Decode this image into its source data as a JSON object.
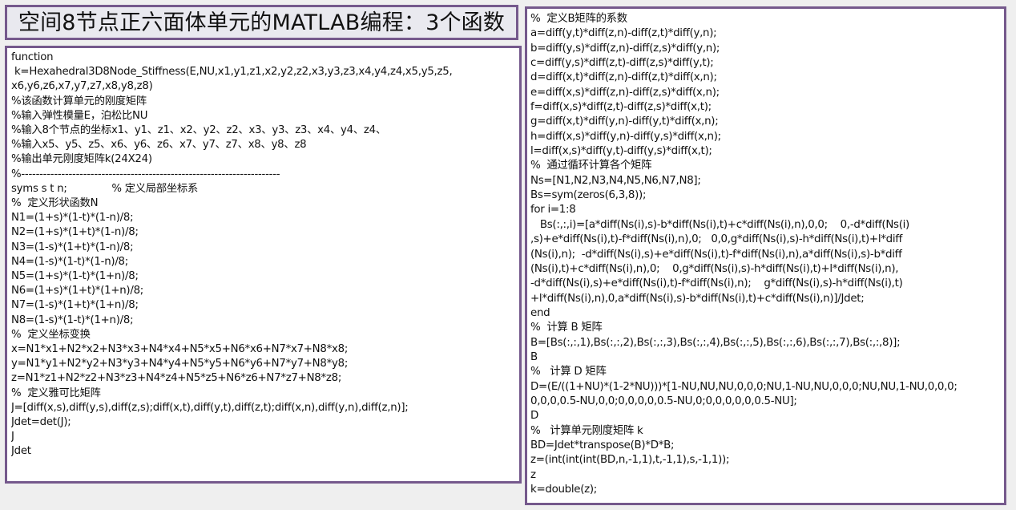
{
  "title": "空间8节点正六面体单元的MATLAB编程：3个函数",
  "left_panel": {
    "lines": [
      "function",
      " k=Hexahedral3D8Node_Stiffness(E,NU,x1,y1,z1,x2,y2,z2,x3,y3,z3,x4,y4,z4,x5,y5,z5,",
      "x6,y6,z6,x7,y7,z7,x8,y8,z8)",
      "%该函数计算单元的刚度矩阵",
      "%输入弹性模量E，泊松比NU",
      "%输入8个节点的坐标x1、y1、z1、x2、y2、z2、x3、y3、z3、x4、y4、z4、",
      "%输入x5、y5、z5、x6、y6、z6、x7、y7、z7、x8、y8、z8",
      "%输出单元刚度矩阵k(24X24)",
      "%-----------------------------------------------------------------------",
      "syms s t n;              % 定义局部坐标系",
      "%  定义形状函数N",
      "N1=(1+s)*(1-t)*(1-n)/8;",
      "N2=(1+s)*(1+t)*(1-n)/8;",
      "N3=(1-s)*(1+t)*(1-n)/8;",
      "N4=(1-s)*(1-t)*(1-n)/8;",
      "N5=(1+s)*(1-t)*(1+n)/8;",
      "N6=(1+s)*(1+t)*(1+n)/8;",
      "N7=(1-s)*(1+t)*(1+n)/8;",
      "N8=(1-s)*(1-t)*(1+n)/8;",
      "%  定义坐标变换",
      "x=N1*x1+N2*x2+N3*x3+N4*x4+N5*x5+N6*x6+N7*x7+N8*x8;",
      "y=N1*y1+N2*y2+N3*y3+N4*y4+N5*y5+N6*y6+N7*y7+N8*y8;",
      "z=N1*z1+N2*z2+N3*z3+N4*z4+N5*z5+N6*z6+N7*z7+N8*z8;",
      "%  定义雅可比矩阵",
      "J=[diff(x,s),diff(y,s),diff(z,s);diff(x,t),diff(y,t),diff(z,t);diff(x,n),diff(y,n),diff(z,n)];",
      "Jdet=det(J);",
      "J",
      "Jdet"
    ]
  },
  "right_panel": {
    "lines": [
      "%  定义B矩阵的系数",
      "a=diff(y,t)*diff(z,n)-diff(z,t)*diff(y,n);",
      "b=diff(y,s)*diff(z,n)-diff(z,s)*diff(y,n);",
      "c=diff(y,s)*diff(z,t)-diff(z,s)*diff(y,t);",
      "d=diff(x,t)*diff(z,n)-diff(z,t)*diff(x,n);",
      "e=diff(x,s)*diff(z,n)-diff(z,s)*diff(x,n);",
      "f=diff(x,s)*diff(z,t)-diff(z,s)*diff(x,t);",
      "g=diff(x,t)*diff(y,n)-diff(y,t)*diff(x,n);",
      "h=diff(x,s)*diff(y,n)-diff(y,s)*diff(x,n);",
      "l=diff(x,s)*diff(y,t)-diff(y,s)*diff(x,t);",
      "%  通过循环计算各个矩阵",
      "Ns=[N1,N2,N3,N4,N5,N6,N7,N8];",
      "Bs=sym(zeros(6,3,8));",
      "for i=1:8",
      "   Bs(:,:,i)=[a*diff(Ns(i),s)-b*diff(Ns(i),t)+c*diff(Ns(i),n),0,0;    0,-d*diff(Ns(i)",
      ",s)+e*diff(Ns(i),t)-f*diff(Ns(i),n),0;   0,0,g*diff(Ns(i),s)-h*diff(Ns(i),t)+l*diff",
      "(Ns(i),n);  -d*diff(Ns(i),s)+e*diff(Ns(i),t)-f*diff(Ns(i),n),a*diff(Ns(i),s)-b*diff",
      "(Ns(i),t)+c*diff(Ns(i),n),0;    0,g*diff(Ns(i),s)-h*diff(Ns(i),t)+l*diff(Ns(i),n),",
      "-d*diff(Ns(i),s)+e*diff(Ns(i),t)-f*diff(Ns(i),n);    g*diff(Ns(i),s)-h*diff(Ns(i),t)",
      "+l*diff(Ns(i),n),0,a*diff(Ns(i),s)-b*diff(Ns(i),t)+c*diff(Ns(i),n)]/Jdet;",
      "end",
      "%  计算 B 矩阵",
      "B=[Bs(:,:,1),Bs(:,:,2),Bs(:,:,3),Bs(:,:,4),Bs(:,:,5),Bs(:,:,6),Bs(:,:,7),Bs(:,:,8)];",
      "B",
      "%   计算 D 矩阵",
      "D=(E/((1+NU)*(1-2*NU)))*[1-NU,NU,NU,0,0,0;NU,1-NU,NU,0,0,0;NU,NU,1-NU,0,0,0;",
      "0,0,0,0.5-NU,0,0;0,0,0,0,0.5-NU,0;0,0,0,0,0,0.5-NU];",
      "D",
      "%   计算单元刚度矩阵 k",
      "BD=Jdet*transpose(B)*D*B;",
      "z=(int(int(int(BD,n,-1,1),t,-1,1),s,-1,1));",
      "z",
      "k=double(z);"
    ]
  }
}
